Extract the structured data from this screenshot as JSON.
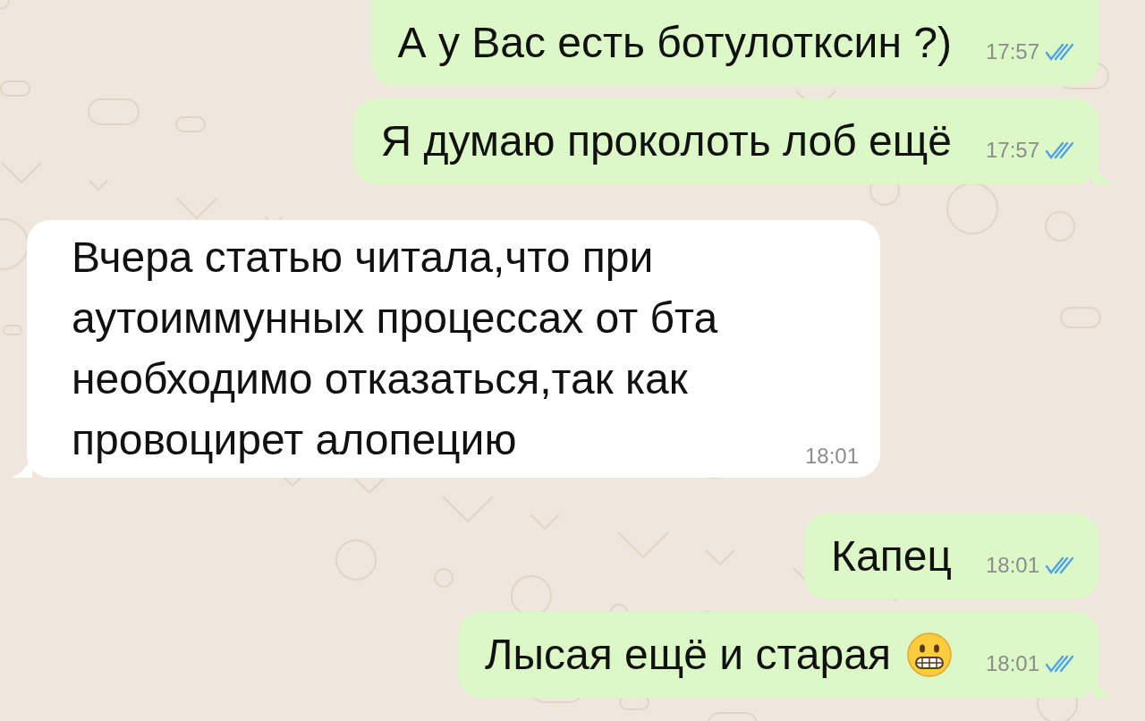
{
  "messages": [
    {
      "kind": "outgoing",
      "text": "А у Вас есть ботулотксин ?)",
      "time": "17:57",
      "read": true,
      "tail": false
    },
    {
      "kind": "outgoing",
      "text": "Я думаю проколоть лоб ещё",
      "time": "17:57",
      "read": true,
      "tail": true
    },
    {
      "kind": "incoming",
      "text": "Вчера статью читала,что при аутоиммунных процессах от бта необходимо отказаться,так как провоцирет алопецию",
      "time": "18:01",
      "tail": true
    },
    {
      "kind": "outgoing",
      "text": "Капец",
      "time": "18:01",
      "read": true,
      "tail": false
    },
    {
      "kind": "outgoing",
      "text": "Лысая ещё и старая",
      "emoji": true,
      "time": "18:01",
      "read": true,
      "tail": true
    }
  ]
}
